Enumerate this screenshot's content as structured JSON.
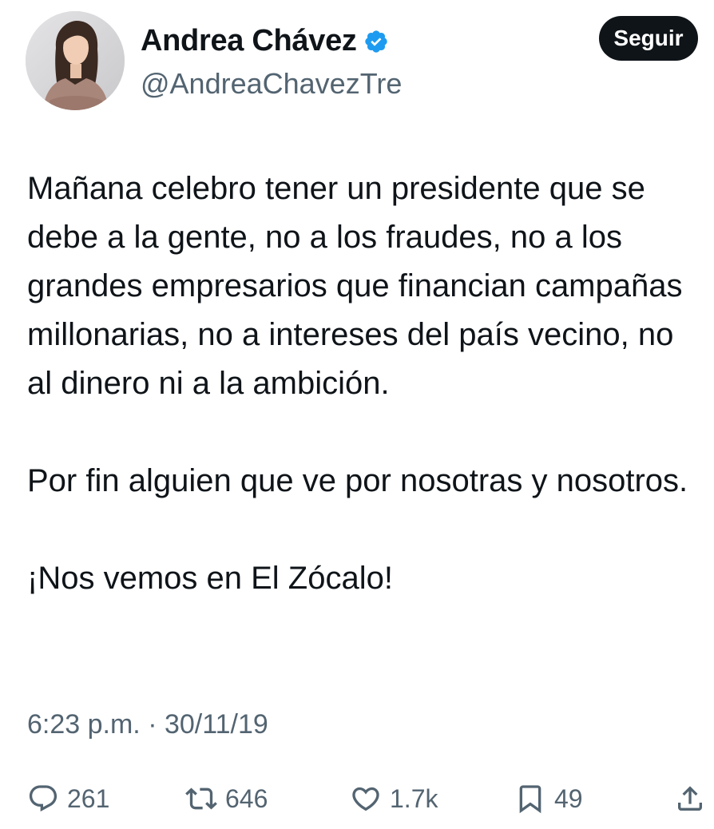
{
  "author": {
    "name": "Andrea Chávez",
    "handle": "@AndreaChavezTre",
    "verified": true
  },
  "follow_button": {
    "label": "Seguir"
  },
  "tweet": {
    "paragraphs": [
      "Mañana celebro tener un presidente que se debe a la gente, no a los fraudes, no a los grandes empresarios que financian campañas millonarias, no a intereses del país vecino, no al dinero ni a la ambición.",
      "Por fin alguien que ve por nosotras y nosotros.",
      "¡Nos vemos en El Zócalo!"
    ],
    "timestamp": "6:23 p.m. · 30/11/19"
  },
  "metrics": {
    "replies": "261",
    "reposts": "646",
    "likes": "1.7k",
    "bookmarks": "49"
  },
  "icons": {
    "verified": "verified-badge-icon",
    "reply": "reply-icon",
    "repost": "repost-icon",
    "like": "heart-icon",
    "bookmark": "bookmark-icon",
    "share": "share-icon"
  },
  "colors": {
    "text": "#0f1419",
    "secondary": "#536471",
    "verified": "#1d9bf0",
    "button_bg": "#0f1419",
    "button_text": "#ffffff"
  }
}
